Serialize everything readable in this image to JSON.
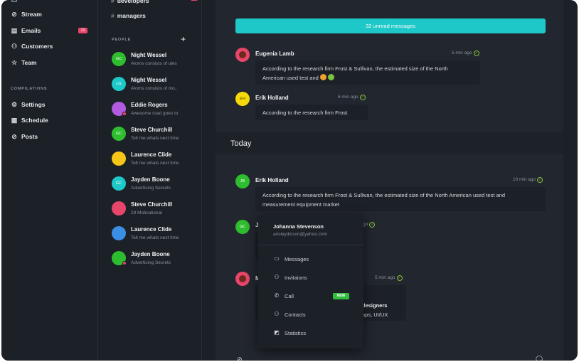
{
  "nav": {
    "items": [
      {
        "label": "Stream",
        "icon": "stream-icon"
      },
      {
        "label": "Emails",
        "icon": "mail-icon",
        "badge": "23"
      },
      {
        "label": "Customers",
        "icon": "users-icon"
      },
      {
        "label": "Team",
        "icon": "star-icon"
      }
    ],
    "section_label": "COMPILATIONS",
    "section_items": [
      {
        "label": "Settings",
        "icon": "gear-icon"
      },
      {
        "label": "Schedule",
        "icon": "calendar-icon"
      },
      {
        "label": "Posts",
        "icon": "link-icon"
      }
    ]
  },
  "channels": [
    {
      "hash": "#",
      "label": "developers",
      "badge": "12"
    },
    {
      "hash": "#",
      "label": "managers"
    }
  ],
  "people": {
    "label": "PEOPLE",
    "add": "+",
    "contacts": [
      {
        "name": "Night Wessel",
        "sub": "Atoms consists of ules",
        "initials": "GC",
        "color": "#2ebd2e",
        "status": ""
      },
      {
        "name": "Night Wessel",
        "sub": "Atoms consists of mo..",
        "initials": "LG",
        "color": "#1ec8c8",
        "status": ""
      },
      {
        "name": "Eddie Rogers",
        "sub": "Awesome road goes to",
        "initials": "",
        "color": "#b05be0",
        "status": "#e8456b"
      },
      {
        "name": "Steve Churchill",
        "sub": "Tell me whats next time",
        "initials": "GC",
        "color": "#2ebd2e",
        "status": ""
      },
      {
        "name": "Laurence Clide",
        "sub": "Tell me whats next time",
        "initials": "",
        "color": "#f5c518",
        "status": ""
      },
      {
        "name": "Jayden Boone",
        "sub": "Advertising Secrets",
        "initials": "GC",
        "color": "#1ec8c8",
        "status": ""
      },
      {
        "name": "Steve Churchill",
        "sub": "29 Motivational",
        "initials": "",
        "color": "#e8456b",
        "status": ""
      },
      {
        "name": "Laurence Clide",
        "sub": "Tell me whats next time",
        "initials": "",
        "color": "#3a8ee6",
        "status": ""
      },
      {
        "name": "Jayden Boone",
        "sub": "Advertising Secrets",
        "initials": "",
        "color": "#2ebd2e",
        "status": "#e8456b"
      }
    ]
  },
  "chat": {
    "unread": "32 unread messages",
    "messages": [
      {
        "name": "Eugenia Lamb",
        "time": "5 min ago",
        "text": "According to the research firm Frost & Sullivan, the estimated size of the North",
        "text2": "American used test and",
        "avatar_initials": "",
        "avatar_color": "#e8456b"
      },
      {
        "name": "Erik Holland",
        "time": "6 min ago",
        "text": "According to the research firm Frost",
        "avatar_initials": "EH",
        "avatar_color": "#f5d90a"
      }
    ],
    "today_label": "Today",
    "today_messages": [
      {
        "name": "Erik Holland",
        "time": "10 min ago",
        "text": "According to the research firm Frost & Sullivan, the estimated size of the North American used test and",
        "text2": "measurement equipment market",
        "avatar_initials": "JB",
        "avatar_color": "#2ebd2e"
      },
      {
        "name": "J",
        "time": "go",
        "avatar_initials": "GC",
        "avatar_color": "#2ebd2e"
      },
      {
        "name": "M",
        "time": "5 min ago",
        "text": "designers",
        "text2": "aps, UI/UX",
        "avatar_initials": "",
        "avatar_color": "#e8456b"
      }
    ]
  },
  "popup": {
    "name": "Johanna Stevenson",
    "email": "ansleydicson@yahoo.com",
    "items": [
      {
        "label": "Messages",
        "icon": "message-icon"
      },
      {
        "label": "Invitaions",
        "icon": "user-icon"
      },
      {
        "label": "Call",
        "icon": "phone-icon",
        "badge": "NEW"
      },
      {
        "label": "Contacts",
        "icon": "contacts-icon"
      },
      {
        "label": "Statistics",
        "icon": "chart-icon"
      }
    ]
  }
}
